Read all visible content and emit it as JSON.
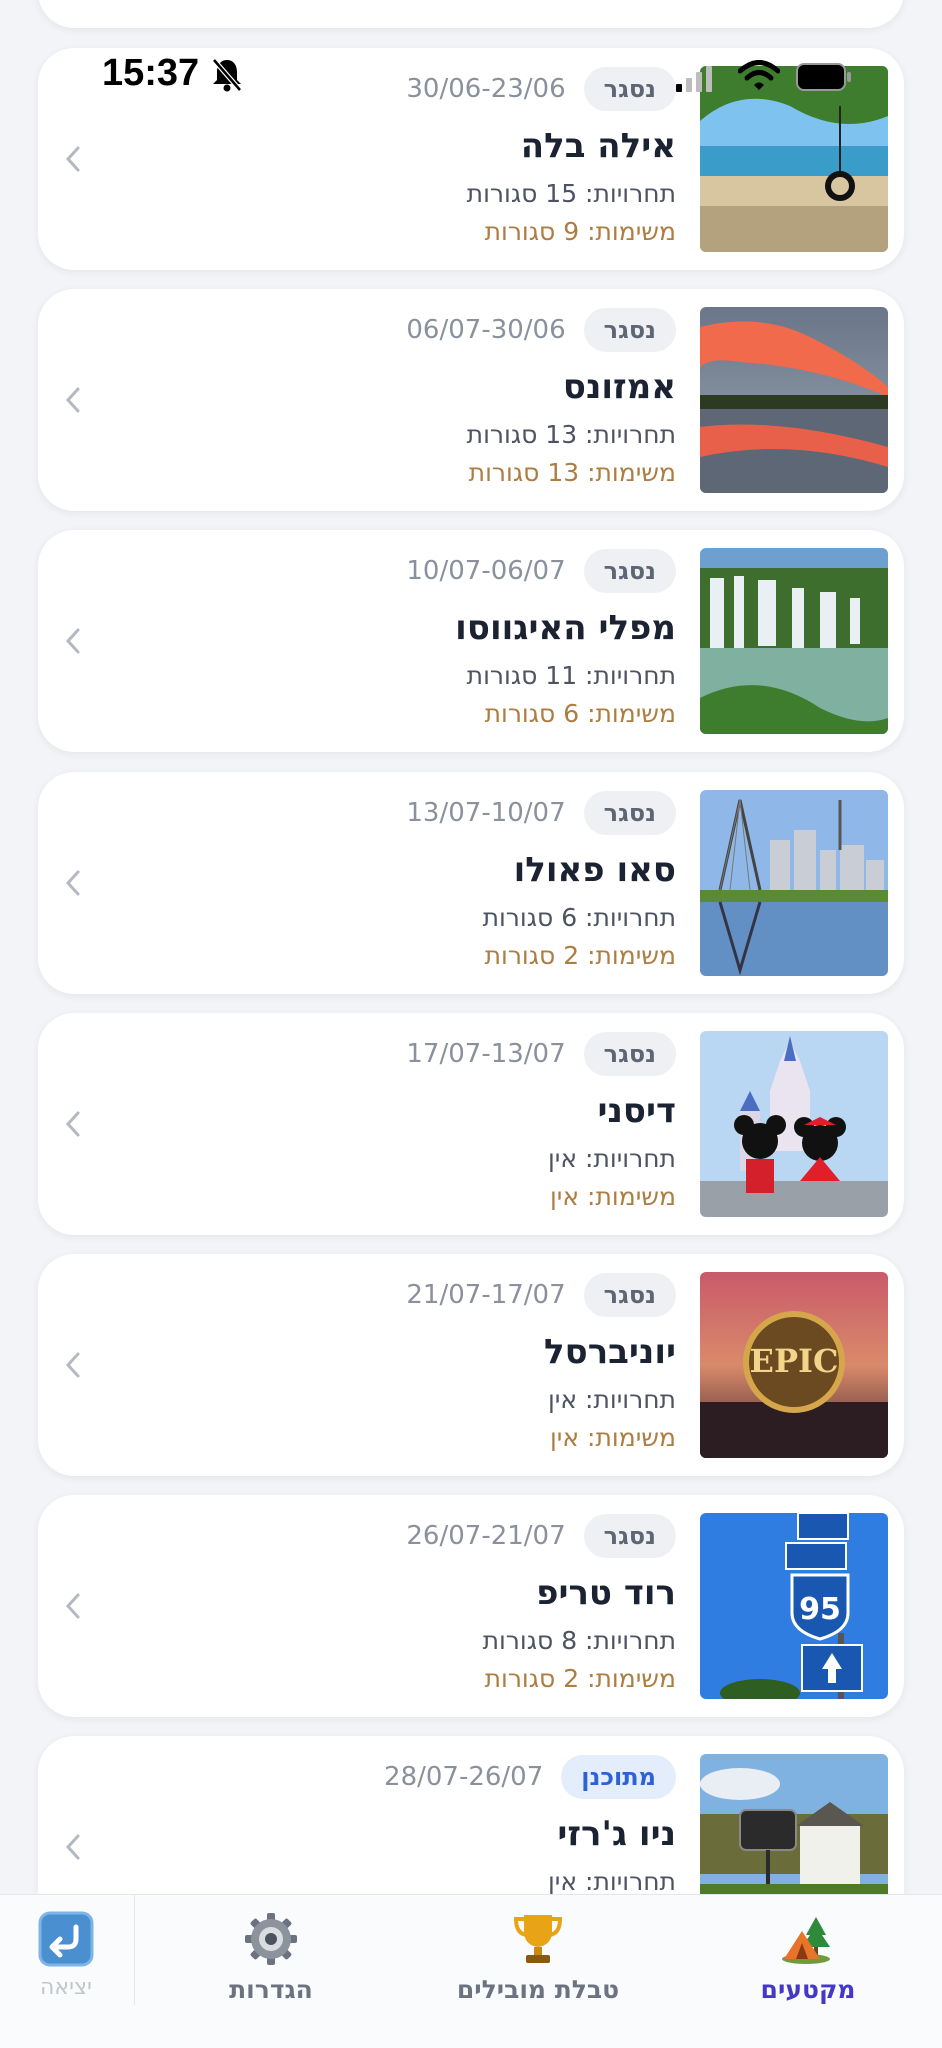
{
  "status_bar": {
    "time": "15:37"
  },
  "trips": [
    {
      "status": "נסגר",
      "status_type": "closed",
      "dates": "30/06-23/06",
      "title": "אילה בלה",
      "challenges": "תחרויות: 15 סגורות",
      "tasks": "משימות: 9 סגורות",
      "image": "beach-swing"
    },
    {
      "status": "נסגר",
      "status_type": "closed",
      "dates": "06/07-30/06",
      "title": "אמזונס",
      "challenges": "תחרויות: 13 סגורות",
      "tasks": "משימות: 13 סגורות",
      "image": "amazon-sunset"
    },
    {
      "status": "נסגר",
      "status_type": "closed",
      "dates": "10/07-06/07",
      "title": "מפלי האיגווסו",
      "challenges": "תחרויות: 11 סגורות",
      "tasks": "משימות: 6 סגורות",
      "image": "waterfalls"
    },
    {
      "status": "נסגר",
      "status_type": "closed",
      "dates": "13/07-10/07",
      "title": "סאו פאולו",
      "challenges": "תחרויות: 6 סגורות",
      "tasks": "משימות: 2 סגורות",
      "image": "city-bridge"
    },
    {
      "status": "נסגר",
      "status_type": "closed",
      "dates": "17/07-13/07",
      "title": "דיסני",
      "challenges": "תחרויות: אין",
      "tasks": "משימות: אין",
      "image": "castle-mickey"
    },
    {
      "status": "נסגר",
      "status_type": "closed",
      "dates": "21/07-17/07",
      "title": "יוניברסל",
      "challenges": "תחרויות: אין",
      "tasks": "משימות: אין",
      "image": "epic-universe",
      "image_text": "EPIC"
    },
    {
      "status": "נסגר",
      "status_type": "closed",
      "dates": "26/07-21/07",
      "title": "רוד טריפ",
      "challenges": "תחרויות: 8 סגורות",
      "tasks": "משימות: 2 סגורות",
      "image": "highway-sign",
      "image_text": "95"
    },
    {
      "status": "מתוכנן",
      "status_type": "planned",
      "dates": "28/07-26/07",
      "title": "ניו ג'רזי",
      "challenges": "תחרויות: אין",
      "tasks": "",
      "image": "town-sign"
    }
  ],
  "tabbar": {
    "segments": "מקטעים",
    "leaderboard": "טבלת מובילים",
    "settings": "הגדרות",
    "exit": "יציאה"
  },
  "colors": {
    "accent": "#4338ca",
    "tasks": "#ad7d42",
    "planned_badge": "#2d62d6"
  }
}
